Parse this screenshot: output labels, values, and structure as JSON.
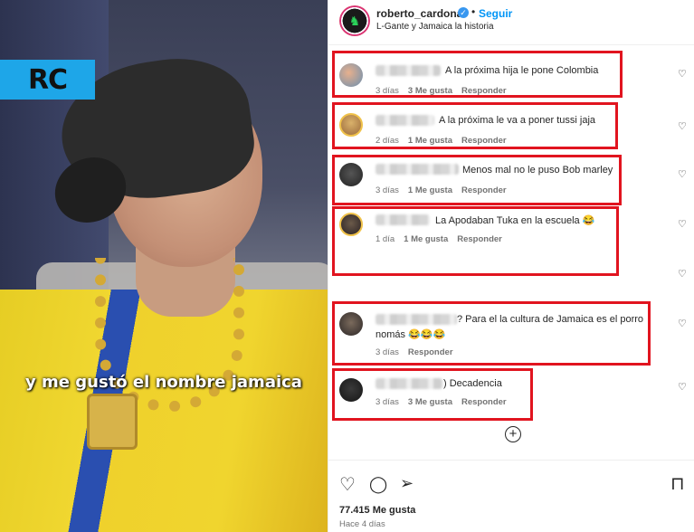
{
  "video": {
    "badge": "RC",
    "caption": "y me gustó el nombre jamaica"
  },
  "header": {
    "username": "roberto_cardona",
    "follow_label": "Seguir",
    "separator": "•",
    "subtitle": "L-Gante y Jamaica la historia",
    "more_glyph": "⋮"
  },
  "comments": [
    {
      "text": "A la próxima hija le pone Colombia",
      "time": "3 días",
      "likes": "3 Me gusta",
      "reply": "Responder"
    },
    {
      "text": "A la próxima le va a poner tussi jaja",
      "time": "2 días",
      "likes": "1 Me gusta",
      "reply": "Responder"
    },
    {
      "text": "Menos mal no le puso Bob marley",
      "time": "3 días",
      "likes": "1 Me gusta",
      "reply": "Responder"
    },
    {
      "text": "La Apodaban Tuka en la escuela 😂",
      "time": "1 día",
      "likes": "1 Me gusta",
      "reply": "Responder"
    },
    {
      "text": "? Para el la cultura de Jamaica es el porro",
      "text2": "nomás 😂😂😂",
      "time": "3 días",
      "likes": "",
      "reply": "Responder"
    },
    {
      "text": ") Decadencia",
      "time": "3 días",
      "likes": "3 Me gusta",
      "reply": "Responder"
    }
  ],
  "icons": {
    "heart": "♡",
    "plus": "+",
    "like": "♡",
    "comment": "◯",
    "share": "➢",
    "save": "⊓"
  },
  "footer": {
    "likes": "77.415 Me gusta",
    "ago": "Hace 4 días"
  },
  "colors": {
    "link": "#0095f6",
    "highlight": "#e1141f",
    "rc_badge": "#1ea6e8"
  }
}
